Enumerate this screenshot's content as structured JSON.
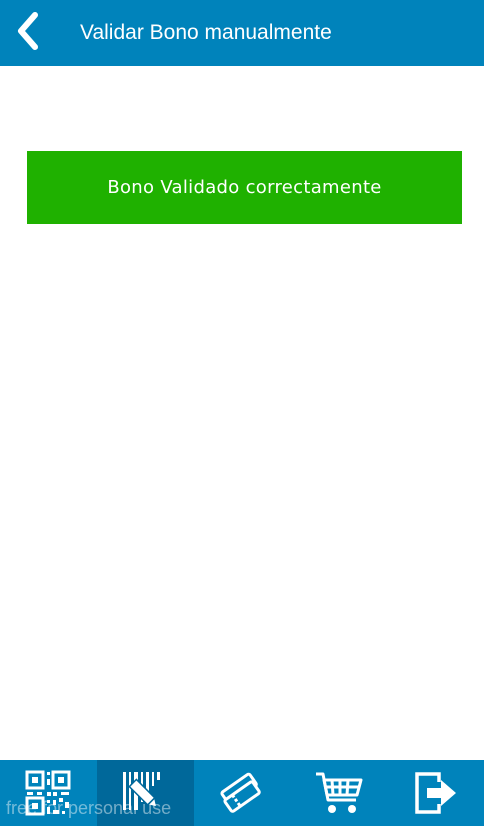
{
  "header": {
    "title": "Validar Bono manualmente",
    "back_icon": "chevron-left-icon",
    "background": "#0083bb"
  },
  "main": {
    "status_message": "Bono Validado correctamente",
    "status_color": "#1fb100"
  },
  "bottom_nav": {
    "items": [
      {
        "icon": "qr-code-icon",
        "active": false
      },
      {
        "icon": "barcode-edit-icon",
        "active": true
      },
      {
        "icon": "tickets-icon",
        "active": false
      },
      {
        "icon": "shopping-cart-icon",
        "active": false
      },
      {
        "icon": "logout-icon",
        "active": false
      }
    ],
    "active_color": "#00689a"
  },
  "watermark": "free for personal use"
}
